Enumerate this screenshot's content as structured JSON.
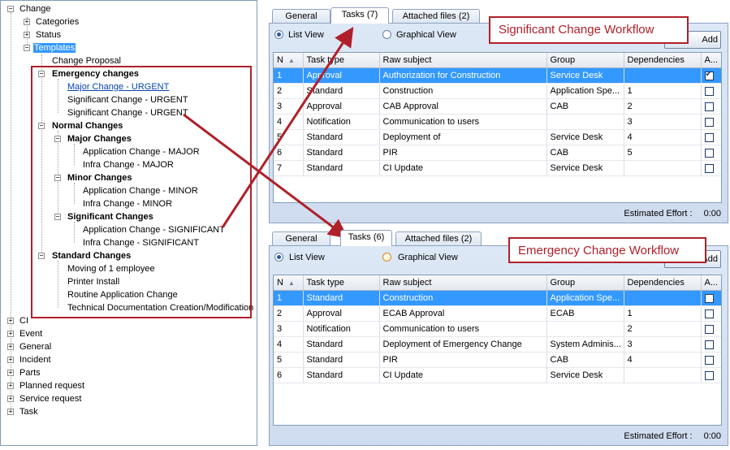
{
  "tree": {
    "root": "Change",
    "categories": "Categories",
    "status": "Status",
    "templates": "Templates",
    "change_proposal": "Change Proposal",
    "emergency": {
      "label": "Emergency changes",
      "items": [
        "Major Change - URGENT",
        "Significant Change - URGENT",
        "Significant Change - URGENT"
      ]
    },
    "normal": {
      "label": "Normal Changes",
      "major": {
        "label": "Major Changes",
        "items": [
          "Application Change - MAJOR",
          "Infra Change - MAJOR"
        ]
      },
      "minor": {
        "label": "Minor Changes",
        "items": [
          "Application Change - MINOR",
          "Infra Change - MINOR"
        ]
      },
      "significant": {
        "label": "Significant Changes",
        "items": [
          "Application Change - SIGNIFICANT",
          "Infra Change - SIGNIFICANT"
        ]
      }
    },
    "standard": {
      "label": "Standard Changes",
      "items": [
        "Moving of 1 employee",
        "Printer Install",
        "Routine Application Change",
        "Technical Documentation Creation/Modification"
      ]
    },
    "others": [
      "CI",
      "Event",
      "General",
      "Incident",
      "Parts",
      "Planned request",
      "Service request",
      "Task"
    ]
  },
  "panel1": {
    "tabs": [
      "General",
      "Tasks (7)",
      "Attached files (2)"
    ],
    "radio_list": "List View",
    "radio_graphical": "Graphical View",
    "add_button": "Add",
    "columns": [
      "N",
      "Task type",
      "Raw subject",
      "Group",
      "Dependencies",
      "A..."
    ],
    "rows": [
      {
        "n": "1",
        "type": "Approval",
        "subject": "Authorization for Construction",
        "group": "Service Desk",
        "deps": "",
        "checked": true
      },
      {
        "n": "2",
        "type": "Standard",
        "subject": "Construction",
        "group": "Application Spe...",
        "deps": "1",
        "checked": false
      },
      {
        "n": "3",
        "type": "Approval",
        "subject": "CAB Approval",
        "group": "CAB",
        "deps": "2",
        "checked": false
      },
      {
        "n": "4",
        "type": "Notification",
        "subject": "Communication to users",
        "group": "",
        "deps": "3",
        "checked": false
      },
      {
        "n": "5",
        "type": "Standard",
        "subject": "Deployment of",
        "group": "Service Desk",
        "deps": "4",
        "checked": false
      },
      {
        "n": "6",
        "type": "Standard",
        "subject": "PIR",
        "group": "CAB",
        "deps": "5",
        "checked": false
      },
      {
        "n": "7",
        "type": "Standard",
        "subject": "CI Update",
        "group": "Service Desk",
        "deps": "",
        "checked": false
      }
    ],
    "effort_label": "Estimated Effort :",
    "effort_value": "0:00"
  },
  "panel2": {
    "tabs": [
      "General",
      "Tasks (6)",
      "Attached files (2)"
    ],
    "radio_list": "List View",
    "radio_graphical": "Graphical View",
    "add_button": "Add",
    "columns": [
      "N",
      "Task type",
      "Raw subject",
      "Group",
      "Dependencies",
      "A..."
    ],
    "rows": [
      {
        "n": "1",
        "type": "Standard",
        "subject": "Construction",
        "group": "Application Spe...",
        "deps": "",
        "checked": false
      },
      {
        "n": "2",
        "type": "Approval",
        "subject": "ECAB Approval",
        "group": "ECAB",
        "deps": "1",
        "checked": false
      },
      {
        "n": "3",
        "type": "Notification",
        "subject": "Communication to users",
        "group": "",
        "deps": "2",
        "checked": false
      },
      {
        "n": "4",
        "type": "Standard",
        "subject": "Deployment of Emergency Change",
        "group": "System Adminis...",
        "deps": "3",
        "checked": false
      },
      {
        "n": "5",
        "type": "Standard",
        "subject": "PIR",
        "group": "CAB",
        "deps": "4",
        "checked": false
      },
      {
        "n": "6",
        "type": "Standard",
        "subject": "CI Update",
        "group": "Service Desk",
        "deps": "",
        "checked": false
      }
    ],
    "effort_label": "Estimated Effort :",
    "effort_value": "0:00"
  },
  "callouts": {
    "significant": "Significant Change Workflow",
    "emergency": "Emergency Change Workflow"
  },
  "colors": {
    "annotation": "#b0202a",
    "selection": "#3399ff"
  }
}
